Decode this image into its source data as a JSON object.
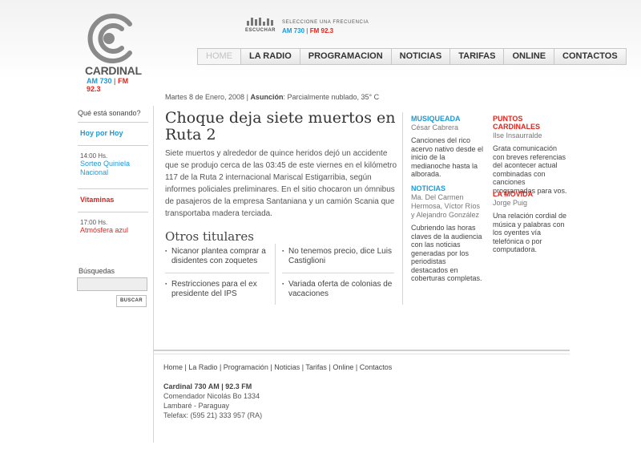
{
  "brand": {
    "name": "CARDINAL",
    "am": "AM 730",
    "separator": "|",
    "fm": "FM 92.3",
    "colors": {
      "am": "#1a9ad6",
      "fm": "#e2231a",
      "logo": "#555555"
    }
  },
  "listen": {
    "label": "ESCUCHAR",
    "prompt": "SELECCIONE UNA FRECUENCIA",
    "am": "AM 730",
    "separator": "|",
    "fm": "FM 92.3",
    "icon": "equalizer-icon"
  },
  "nav": {
    "items": [
      {
        "label": "HOME",
        "active": true
      },
      {
        "label": "LA RADIO"
      },
      {
        "label": "PROGRAMACION"
      },
      {
        "label": "NOTICIAS"
      },
      {
        "label": "TARIFAS"
      },
      {
        "label": "ONLINE"
      },
      {
        "label": "CONTACTOS"
      }
    ]
  },
  "datebar": {
    "date": "Martes 8 de Enero, 2008",
    "sep": "|",
    "city": "Asunción",
    "weather": ": Parcialmente nublado, 35° C"
  },
  "sidebar": {
    "question": "Qué está sonando?",
    "today_header": "Hoy por Hoy",
    "slot1_time": "14:00 Hs.",
    "slot1_program": "Sorteo Quiniela Nacional",
    "feature_header": "Vitaminas",
    "slot2_time": "17:00 Hs.",
    "slot2_program": "Atmósfera azul"
  },
  "search": {
    "label": "Búsquedas",
    "value": "",
    "button": "BUSCAR"
  },
  "story": {
    "title": "Choque deja siete muertos en Ruta 2",
    "body": "Siete muertos y alrededor de quince heridos dejó un accidente que se produjo cerca de las 03:45 de este viernes en el kilómetro 117 de la Ruta 2 internacional Mariscal Estigarribia, según informes policiales preliminares. En el sitio chocaron un ómnibus de pasajeros de la empresa Santaniana y un camión Scania que transportaba madera terciada."
  },
  "others": {
    "title": "Otros titulares",
    "items": [
      "Nicanor plantea comprar a disidentes con zoquetes",
      "No tenemos precio, dice Luis Castiglioni",
      "Restricciones para el ex presidente del IPS",
      "Variada oferta de colonias de vacaciones"
    ]
  },
  "columns": {
    "musiqueada": {
      "title": "MUSIQUEADA",
      "author": "César Cabrera",
      "desc": "Canciones del rico acervo nativo desde el inicio de la medianoche hasta la alborada."
    },
    "noticias": {
      "title": "NOTICIAS",
      "author": "Ma. Del Carmen Hermosa, Víctor Ríos y Alejandro González",
      "desc": "Cubriendo las horas claves de la audiencia con las noticias generadas por los periodistas destacados en coberturas completas."
    },
    "puntos": {
      "title": "PUNTOS CARDINALES",
      "author": "Ilse Insaurralde",
      "desc": "Grata comunicación con breves referencias del acontecer actual combinadas con canciones programadas para vos."
    },
    "movida": {
      "title": "LA MOVIDA",
      "author": "Jorge Puig",
      "desc": "Una relación cordial de música y palabras con los oyentes vía telefónica o por computadora."
    }
  },
  "footer": {
    "links": [
      "Home",
      "La Radio",
      "Programación",
      "Noticias",
      "Tarifas",
      "Online",
      "Contactos"
    ],
    "link_sep": "|",
    "station": "Cardinal 730 AM | 92.3 FM",
    "address1": "Comendador Nicolás Bo 1334",
    "address2": "Lambaré - Paraguay",
    "phone": "Telefax: (595 21) 333 957 (RA)"
  }
}
